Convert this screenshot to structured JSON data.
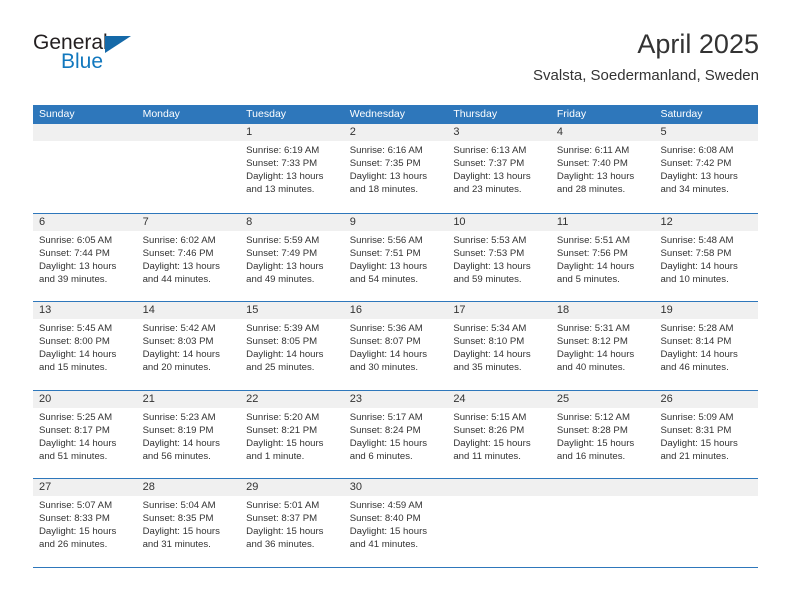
{
  "brand": {
    "name_top": "General",
    "name_bottom": "Blue",
    "accent_color": "#1569a8",
    "blue_text_color": "#1278be"
  },
  "header": {
    "title": "April 2025",
    "subtitle": "Svalsta, Soedermanland, Sweden"
  },
  "theme": {
    "header_bg": "#2e77bb",
    "day_band_bg": "#f0f0f0",
    "separator_color": "#2e77bb",
    "text_color": "#333333"
  },
  "weekdays": [
    "Sunday",
    "Monday",
    "Tuesday",
    "Wednesday",
    "Thursday",
    "Friday",
    "Saturday"
  ],
  "weeks": [
    [
      {
        "day": "",
        "empty": true,
        "sunrise": "",
        "sunset": "",
        "daylight_line1": "",
        "daylight_line2": ""
      },
      {
        "day": "",
        "empty": true,
        "sunrise": "",
        "sunset": "",
        "daylight_line1": "",
        "daylight_line2": ""
      },
      {
        "day": "1",
        "sunrise": "Sunrise: 6:19 AM",
        "sunset": "Sunset: 7:33 PM",
        "daylight_line1": "Daylight: 13 hours",
        "daylight_line2": "and 13 minutes."
      },
      {
        "day": "2",
        "sunrise": "Sunrise: 6:16 AM",
        "sunset": "Sunset: 7:35 PM",
        "daylight_line1": "Daylight: 13 hours",
        "daylight_line2": "and 18 minutes."
      },
      {
        "day": "3",
        "sunrise": "Sunrise: 6:13 AM",
        "sunset": "Sunset: 7:37 PM",
        "daylight_line1": "Daylight: 13 hours",
        "daylight_line2": "and 23 minutes."
      },
      {
        "day": "4",
        "sunrise": "Sunrise: 6:11 AM",
        "sunset": "Sunset: 7:40 PM",
        "daylight_line1": "Daylight: 13 hours",
        "daylight_line2": "and 28 minutes."
      },
      {
        "day": "5",
        "sunrise": "Sunrise: 6:08 AM",
        "sunset": "Sunset: 7:42 PM",
        "daylight_line1": "Daylight: 13 hours",
        "daylight_line2": "and 34 minutes."
      }
    ],
    [
      {
        "day": "6",
        "sunrise": "Sunrise: 6:05 AM",
        "sunset": "Sunset: 7:44 PM",
        "daylight_line1": "Daylight: 13 hours",
        "daylight_line2": "and 39 minutes."
      },
      {
        "day": "7",
        "sunrise": "Sunrise: 6:02 AM",
        "sunset": "Sunset: 7:46 PM",
        "daylight_line1": "Daylight: 13 hours",
        "daylight_line2": "and 44 minutes."
      },
      {
        "day": "8",
        "sunrise": "Sunrise: 5:59 AM",
        "sunset": "Sunset: 7:49 PM",
        "daylight_line1": "Daylight: 13 hours",
        "daylight_line2": "and 49 minutes."
      },
      {
        "day": "9",
        "sunrise": "Sunrise: 5:56 AM",
        "sunset": "Sunset: 7:51 PM",
        "daylight_line1": "Daylight: 13 hours",
        "daylight_line2": "and 54 minutes."
      },
      {
        "day": "10",
        "sunrise": "Sunrise: 5:53 AM",
        "sunset": "Sunset: 7:53 PM",
        "daylight_line1": "Daylight: 13 hours",
        "daylight_line2": "and 59 minutes."
      },
      {
        "day": "11",
        "sunrise": "Sunrise: 5:51 AM",
        "sunset": "Sunset: 7:56 PM",
        "daylight_line1": "Daylight: 14 hours",
        "daylight_line2": "and 5 minutes."
      },
      {
        "day": "12",
        "sunrise": "Sunrise: 5:48 AM",
        "sunset": "Sunset: 7:58 PM",
        "daylight_line1": "Daylight: 14 hours",
        "daylight_line2": "and 10 minutes."
      }
    ],
    [
      {
        "day": "13",
        "sunrise": "Sunrise: 5:45 AM",
        "sunset": "Sunset: 8:00 PM",
        "daylight_line1": "Daylight: 14 hours",
        "daylight_line2": "and 15 minutes."
      },
      {
        "day": "14",
        "sunrise": "Sunrise: 5:42 AM",
        "sunset": "Sunset: 8:03 PM",
        "daylight_line1": "Daylight: 14 hours",
        "daylight_line2": "and 20 minutes."
      },
      {
        "day": "15",
        "sunrise": "Sunrise: 5:39 AM",
        "sunset": "Sunset: 8:05 PM",
        "daylight_line1": "Daylight: 14 hours",
        "daylight_line2": "and 25 minutes."
      },
      {
        "day": "16",
        "sunrise": "Sunrise: 5:36 AM",
        "sunset": "Sunset: 8:07 PM",
        "daylight_line1": "Daylight: 14 hours",
        "daylight_line2": "and 30 minutes."
      },
      {
        "day": "17",
        "sunrise": "Sunrise: 5:34 AM",
        "sunset": "Sunset: 8:10 PM",
        "daylight_line1": "Daylight: 14 hours",
        "daylight_line2": "and 35 minutes."
      },
      {
        "day": "18",
        "sunrise": "Sunrise: 5:31 AM",
        "sunset": "Sunset: 8:12 PM",
        "daylight_line1": "Daylight: 14 hours",
        "daylight_line2": "and 40 minutes."
      },
      {
        "day": "19",
        "sunrise": "Sunrise: 5:28 AM",
        "sunset": "Sunset: 8:14 PM",
        "daylight_line1": "Daylight: 14 hours",
        "daylight_line2": "and 46 minutes."
      }
    ],
    [
      {
        "day": "20",
        "sunrise": "Sunrise: 5:25 AM",
        "sunset": "Sunset: 8:17 PM",
        "daylight_line1": "Daylight: 14 hours",
        "daylight_line2": "and 51 minutes."
      },
      {
        "day": "21",
        "sunrise": "Sunrise: 5:23 AM",
        "sunset": "Sunset: 8:19 PM",
        "daylight_line1": "Daylight: 14 hours",
        "daylight_line2": "and 56 minutes."
      },
      {
        "day": "22",
        "sunrise": "Sunrise: 5:20 AM",
        "sunset": "Sunset: 8:21 PM",
        "daylight_line1": "Daylight: 15 hours",
        "daylight_line2": "and 1 minute."
      },
      {
        "day": "23",
        "sunrise": "Sunrise: 5:17 AM",
        "sunset": "Sunset: 8:24 PM",
        "daylight_line1": "Daylight: 15 hours",
        "daylight_line2": "and 6 minutes."
      },
      {
        "day": "24",
        "sunrise": "Sunrise: 5:15 AM",
        "sunset": "Sunset: 8:26 PM",
        "daylight_line1": "Daylight: 15 hours",
        "daylight_line2": "and 11 minutes."
      },
      {
        "day": "25",
        "sunrise": "Sunrise: 5:12 AM",
        "sunset": "Sunset: 8:28 PM",
        "daylight_line1": "Daylight: 15 hours",
        "daylight_line2": "and 16 minutes."
      },
      {
        "day": "26",
        "sunrise": "Sunrise: 5:09 AM",
        "sunset": "Sunset: 8:31 PM",
        "daylight_line1": "Daylight: 15 hours",
        "daylight_line2": "and 21 minutes."
      }
    ],
    [
      {
        "day": "27",
        "sunrise": "Sunrise: 5:07 AM",
        "sunset": "Sunset: 8:33 PM",
        "daylight_line1": "Daylight: 15 hours",
        "daylight_line2": "and 26 minutes."
      },
      {
        "day": "28",
        "sunrise": "Sunrise: 5:04 AM",
        "sunset": "Sunset: 8:35 PM",
        "daylight_line1": "Daylight: 15 hours",
        "daylight_line2": "and 31 minutes."
      },
      {
        "day": "29",
        "sunrise": "Sunrise: 5:01 AM",
        "sunset": "Sunset: 8:37 PM",
        "daylight_line1": "Daylight: 15 hours",
        "daylight_line2": "and 36 minutes."
      },
      {
        "day": "30",
        "sunrise": "Sunrise: 4:59 AM",
        "sunset": "Sunset: 8:40 PM",
        "daylight_line1": "Daylight: 15 hours",
        "daylight_line2": "and 41 minutes."
      },
      {
        "day": "",
        "empty": true,
        "sunrise": "",
        "sunset": "",
        "daylight_line1": "",
        "daylight_line2": ""
      },
      {
        "day": "",
        "empty": true,
        "sunrise": "",
        "sunset": "",
        "daylight_line1": "",
        "daylight_line2": ""
      },
      {
        "day": "",
        "empty": true,
        "sunrise": "",
        "sunset": "",
        "daylight_line1": "",
        "daylight_line2": ""
      }
    ]
  ]
}
